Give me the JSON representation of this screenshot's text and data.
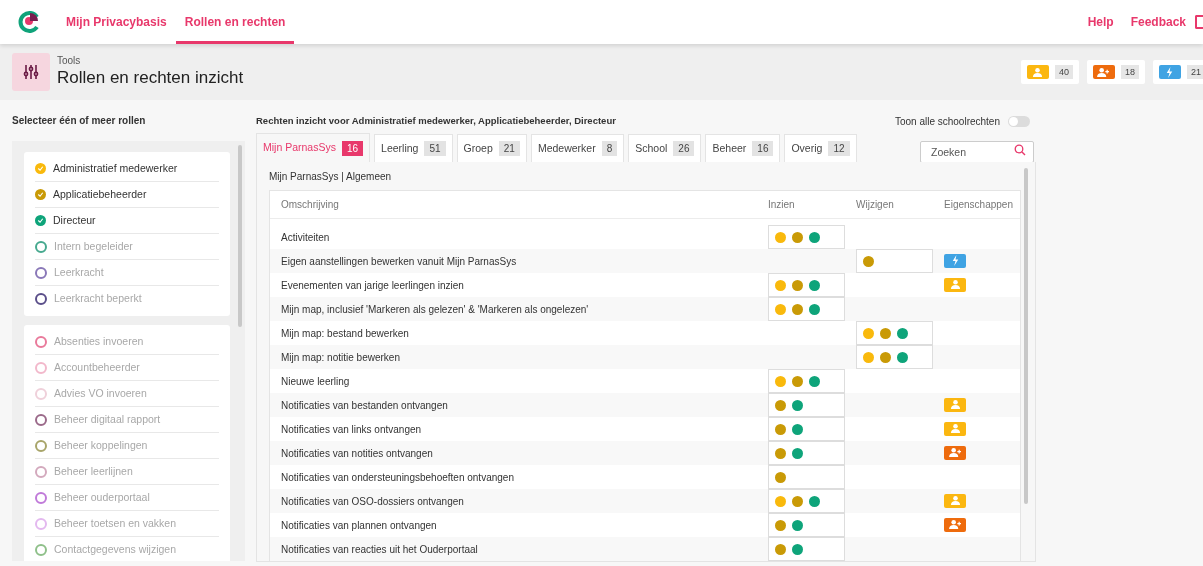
{
  "nav": {
    "items": [
      {
        "label": "Mijn Privacybasis",
        "selected": false
      },
      {
        "label": "Rollen en rechten",
        "selected": true
      }
    ],
    "links": [
      "Help",
      "Feedback"
    ]
  },
  "header": {
    "section": "Tools",
    "title": "Rollen en rechten inzicht"
  },
  "summary": [
    {
      "kind": "user",
      "count": "40"
    },
    {
      "kind": "user-plus",
      "count": "18"
    },
    {
      "kind": "bolt",
      "count": "21"
    }
  ],
  "sidebar": {
    "heading": "Selecteer één of meer rollen",
    "groups": [
      [
        {
          "label": "Administratief medewerker",
          "selected": true,
          "color": "#f9b90c"
        },
        {
          "label": "Applicatiebeheerder",
          "selected": true,
          "color": "#c99a06"
        },
        {
          "label": "Directeur",
          "selected": true,
          "color": "#0ea47a"
        },
        {
          "label": "Intern begeleider",
          "selected": false,
          "color": "#47a98f"
        },
        {
          "label": "Leerkracht",
          "selected": false,
          "color": "#8a78b8"
        },
        {
          "label": "Leerkracht beperkt",
          "selected": false,
          "color": "#5b4f8a"
        }
      ],
      [
        {
          "label": "Absenties invoeren",
          "selected": false,
          "color": "#e97a9b"
        },
        {
          "label": "Accountbeheerder",
          "selected": false,
          "color": "#f2b8cb"
        },
        {
          "label": "Advies VO invoeren",
          "selected": false,
          "color": "#efd0da"
        },
        {
          "label": "Beheer digitaal rapport",
          "selected": false,
          "color": "#9b6a8a"
        },
        {
          "label": "Beheer koppelingen",
          "selected": false,
          "color": "#a8a56a"
        },
        {
          "label": "Beheer leerlijnen",
          "selected": false,
          "color": "#d3a9bd"
        },
        {
          "label": "Beheer ouderportaal",
          "selected": false,
          "color": "#c07ad9"
        },
        {
          "label": "Beheer toetsen en vakken",
          "selected": false,
          "color": "#e3b8ef"
        },
        {
          "label": "Contactgegevens wijzigen",
          "selected": false,
          "color": "#8fc08a"
        }
      ]
    ]
  },
  "main": {
    "heading": "Rechten inzicht voor Administratief medewerker, Applicatiebeheerder, Directeur",
    "toggle": {
      "label": "Toon alle schoolrechten",
      "on": false
    },
    "tabs": [
      {
        "label": "Mijn ParnasSys",
        "count": "16",
        "selected": true
      },
      {
        "label": "Leerling",
        "count": "51",
        "selected": false
      },
      {
        "label": "Groep",
        "count": "21",
        "selected": false
      },
      {
        "label": "Medewerker",
        "count": "8",
        "selected": false
      },
      {
        "label": "School",
        "count": "26",
        "selected": false
      },
      {
        "label": "Beheer",
        "count": "16",
        "selected": false
      },
      {
        "label": "Overig",
        "count": "12",
        "selected": false
      }
    ],
    "search": {
      "placeholder": "Zoeken"
    },
    "breadcrumb": "Mijn ParnasSys | Algemeen",
    "table": {
      "columns": [
        "Omschrijving",
        "Inzien",
        "Wijzigen",
        "Eigenschappen"
      ],
      "rows": [
        {
          "label": "Activiteiten",
          "inzien": [
            {
              "color": "#f9b90c"
            },
            {
              "color": "#c99a06"
            },
            {
              "color": "#0ea47a"
            }
          ],
          "wijzigen": [],
          "badge": null
        },
        {
          "label": "Eigen aanstellingen bewerken vanuit Mijn ParnasSys",
          "inzien": [],
          "wijzigen": [
            {
              "color": "#c99a06"
            }
          ],
          "badge": {
            "kind": "bolt"
          }
        },
        {
          "label": "Evenementen van jarige leerlingen inzien",
          "inzien": [
            {
              "color": "#f9b90c"
            },
            {
              "color": "#c99a06"
            },
            {
              "color": "#0ea47a"
            }
          ],
          "wijzigen": [],
          "badge": {
            "kind": "user"
          }
        },
        {
          "label": "Mijn map, inclusief 'Markeren als gelezen' & 'Markeren als ongelezen'",
          "inzien": [
            {
              "color": "#f9b90c"
            },
            {
              "color": "#c99a06"
            },
            {
              "color": "#0ea47a"
            }
          ],
          "wijzigen": [],
          "badge": null
        },
        {
          "label": "Mijn map: bestand bewerken",
          "inzien": [],
          "wijzigen": [
            {
              "color": "#f9b90c"
            },
            {
              "color": "#c99a06"
            },
            {
              "color": "#0ea47a"
            }
          ],
          "badge": null
        },
        {
          "label": "Mijn map: notitie bewerken",
          "inzien": [],
          "wijzigen": [
            {
              "color": "#f9b90c"
            },
            {
              "color": "#c99a06"
            },
            {
              "color": "#0ea47a"
            }
          ],
          "badge": null
        },
        {
          "label": "Nieuwe leerling",
          "inzien": [
            {
              "color": "#f9b90c"
            },
            {
              "color": "#c99a06"
            },
            {
              "color": "#0ea47a"
            }
          ],
          "wijzigen": [],
          "badge": null
        },
        {
          "label": "Notificaties van bestanden ontvangen",
          "inzien": [
            {
              "color": "#c99a06"
            },
            {
              "color": "#0ea47a"
            }
          ],
          "wijzigen": [],
          "badge": {
            "kind": "user"
          }
        },
        {
          "label": "Notificaties van links ontvangen",
          "inzien": [
            {
              "color": "#c99a06"
            },
            {
              "color": "#0ea47a"
            }
          ],
          "wijzigen": [],
          "badge": {
            "kind": "user"
          }
        },
        {
          "label": "Notificaties van notities ontvangen",
          "inzien": [
            {
              "color": "#c99a06"
            },
            {
              "color": "#0ea47a"
            }
          ],
          "wijzigen": [],
          "badge": {
            "kind": "user-plus"
          }
        },
        {
          "label": "Notificaties van ondersteuningsbehoeften ontvangen",
          "inzien": [
            {
              "color": "#c99a06"
            }
          ],
          "wijzigen": [],
          "badge": null
        },
        {
          "label": "Notificaties van OSO-dossiers ontvangen",
          "inzien": [
            {
              "color": "#f9b90c"
            },
            {
              "color": "#c99a06"
            },
            {
              "color": "#0ea47a"
            }
          ],
          "wijzigen": [],
          "badge": {
            "kind": "user"
          }
        },
        {
          "label": "Notificaties van plannen ontvangen",
          "inzien": [
            {
              "color": "#c99a06"
            },
            {
              "color": "#0ea47a"
            }
          ],
          "wijzigen": [],
          "badge": {
            "kind": "user-plus"
          }
        },
        {
          "label": "Notificaties van reacties uit het Ouderportaal",
          "inzien": [
            {
              "color": "#c99a06"
            },
            {
              "color": "#0ea47a"
            }
          ],
          "wijzigen": [],
          "badge": null
        }
      ]
    }
  }
}
